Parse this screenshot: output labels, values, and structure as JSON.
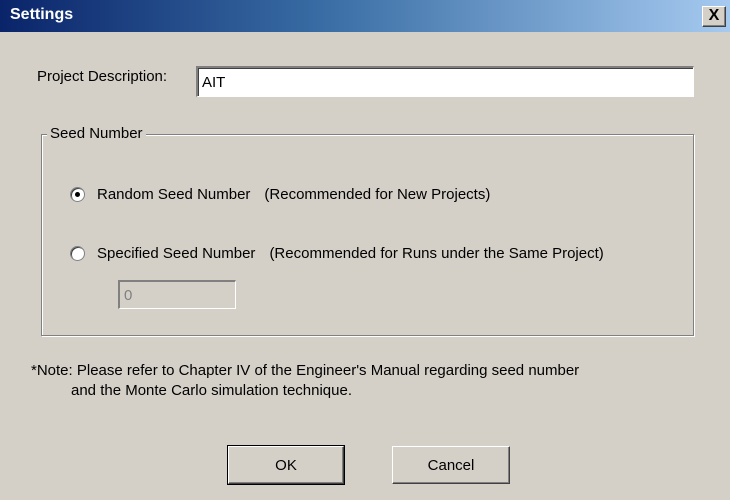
{
  "window": {
    "title": "Settings",
    "close_label": "X"
  },
  "project": {
    "label": "Project Description:",
    "value": "AIT"
  },
  "seed_group": {
    "title": "Seed Number",
    "options": [
      {
        "label": "Random Seed Number",
        "hint": "(Recommended for New Projects)",
        "checked": true
      },
      {
        "label": "Specified Seed Number",
        "hint": "(Recommended for Runs under the Same Project)",
        "checked": false
      }
    ],
    "specified_value": "0"
  },
  "note": {
    "line1": "*Note:  Please refer to Chapter IV of the Engineer's Manual regarding seed number",
    "line2": "and the Monte Carlo simulation technique."
  },
  "buttons": {
    "ok": "OK",
    "cancel": "Cancel"
  }
}
